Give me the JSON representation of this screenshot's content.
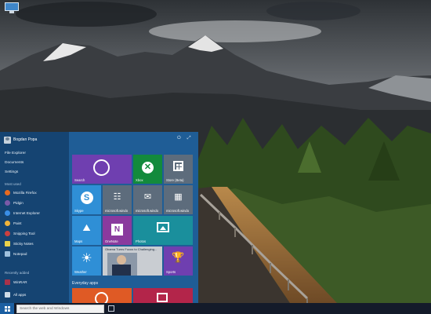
{
  "user": {
    "name": "Bogdan Popa"
  },
  "nav_links": [
    "File Explorer",
    "Documents",
    "Settings"
  ],
  "most_used": {
    "heading": "Most used",
    "items": [
      {
        "label": "Mozilla Firefox",
        "icon": "firefox-icon",
        "color": "#e66a1f"
      },
      {
        "label": "Pidgin",
        "icon": "pidgin-icon",
        "color": "#7a5aa8"
      },
      {
        "label": "Internet Explorer",
        "icon": "internet-explorer-icon",
        "color": "#3a8ee6"
      },
      {
        "label": "Paint",
        "icon": "paint-icon",
        "color": "#f0b43a"
      },
      {
        "label": "Snipping Tool",
        "icon": "snipping-tool-icon",
        "color": "#c93f3f"
      },
      {
        "label": "Sticky Notes",
        "icon": "sticky-notes-icon",
        "color": "#e8d24a"
      },
      {
        "label": "Notepad",
        "icon": "notepad-icon",
        "color": "#9fc1dd"
      }
    ]
  },
  "recently_added": {
    "heading": "Recently added",
    "items": [
      {
        "label": "WinRAR",
        "icon": "winrar-icon",
        "color": "#a8324a"
      }
    ]
  },
  "all_apps_label": "All apps",
  "tiles": {
    "search": "Search",
    "xbox": "Xbox",
    "store": "Store (Beta)",
    "skype": "Skype",
    "ms_a": "microsoft.windo",
    "ms_b": "microsoft.windo",
    "ms_c": "microsoft.windo",
    "maps": "Maps",
    "onenote": "OneNote",
    "photos": "Photos",
    "weather": "Weather",
    "news_headline": "Obama Turns Focus to Challenging...",
    "sports": "Sports"
  },
  "everyday_apps_heading": "Everyday apps",
  "taskbar": {
    "search_placeholder": "Search the web and Windows"
  },
  "colors": {
    "start_menu_bg": "#1f5d96",
    "tile_purple": "#6f3fb0",
    "tile_green": "#138a3c",
    "tile_blue": "#2f8fd6",
    "tile_gray": "#5d6c7c",
    "tile_red": "#b3254a",
    "tile_orange": "#df5a25"
  }
}
